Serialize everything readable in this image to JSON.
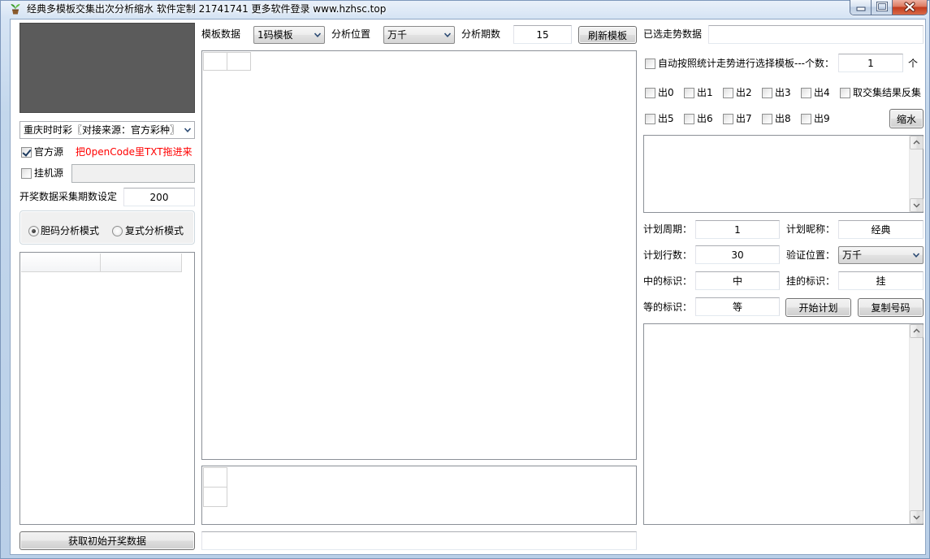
{
  "window": {
    "title": "经典多模板交集出次分析缩水 软件定制 21741741 更多软件登录 www.hzhsc.top"
  },
  "icons": {
    "app": "app-icon",
    "minimize": "minimize-icon",
    "maximize": "maximize-icon",
    "close": "close-icon",
    "dropdown": "chevron-down-icon",
    "scroll_up": "chevron-up-icon",
    "scroll_down": "chevron-down-icon"
  },
  "colors": {
    "hint_text": "#ff0000",
    "preview_panel": "#5b5b5b"
  },
  "left_panel": {
    "source_select": {
      "selected": "重庆时时彩〖对接来源：官方彩种〗"
    },
    "official_source": {
      "label": "官方源",
      "checked": true
    },
    "drag_hint": "把0penCode里TXT拖进来",
    "hang_source": {
      "label": "挂机源",
      "checked": false
    },
    "collect_periods": {
      "label": "开奖数据采集期数设定",
      "value": "200"
    },
    "analysis_modes": [
      {
        "label": "胆码分析模式",
        "selected": true
      },
      {
        "label": "复式分析模式",
        "selected": false
      }
    ],
    "fetch_button": "获取初始开奖数据"
  },
  "toolbar": {
    "template": {
      "label": "模板数据",
      "selected": "1码模板"
    },
    "position": {
      "label": "分析位置",
      "selected": "万千"
    },
    "periods": {
      "label": "分析期数",
      "value": "15"
    },
    "refresh_button": "刷新模板"
  },
  "right_panel": {
    "selected_trend": {
      "label": "已选走势数据"
    },
    "auto_select": {
      "label": "自动按照统计走势进行选择模板---个数：",
      "checked": false,
      "count": "1",
      "unit": "个"
    },
    "outs": [
      {
        "label": "出0",
        "checked": false
      },
      {
        "label": "出1",
        "checked": false
      },
      {
        "label": "出2",
        "checked": false
      },
      {
        "label": "出3",
        "checked": false
      },
      {
        "label": "出4",
        "checked": false
      },
      {
        "label": "出5",
        "checked": false
      },
      {
        "label": "出6",
        "checked": false
      },
      {
        "label": "出7",
        "checked": false
      },
      {
        "label": "出8",
        "checked": false
      },
      {
        "label": "出9",
        "checked": false
      }
    ],
    "invert": {
      "label": "取交集结果反集",
      "checked": false
    },
    "shrink_button": "缩水",
    "plan": {
      "cycle": {
        "label": "计划周期：",
        "value": "1"
      },
      "nickname": {
        "label": "计划昵称：",
        "value": "经典"
      },
      "rows": {
        "label": "计划行数：",
        "value": "30"
      },
      "verify_position": {
        "label": "验证位置：",
        "selected": "万千"
      },
      "hit_mark": {
        "label": "中的标识：",
        "value": "中"
      },
      "miss_mark": {
        "label": "挂的标识：",
        "value": "挂"
      },
      "wait_mark": {
        "label": "等的标识：",
        "value": "等"
      }
    },
    "start_button": "开始计划",
    "copy_button": "复制号码"
  }
}
